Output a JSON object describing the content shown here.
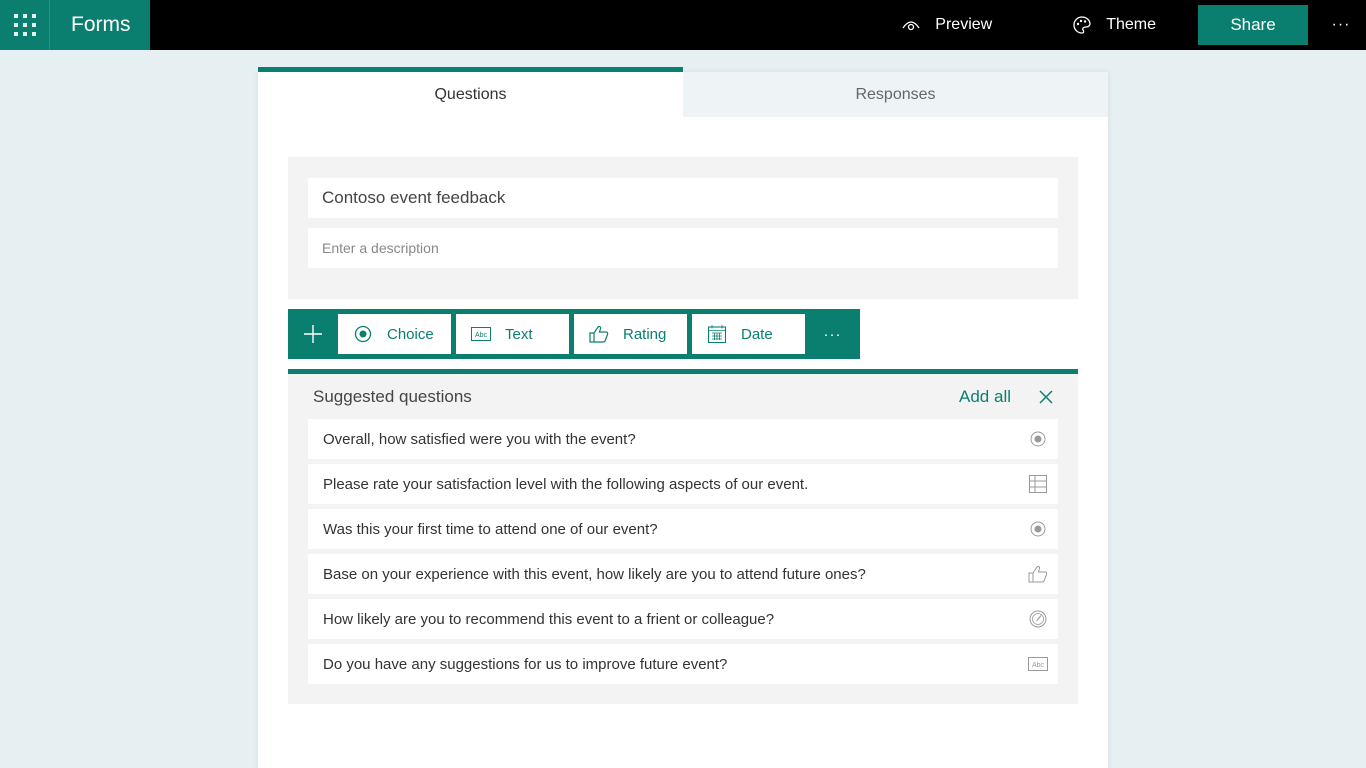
{
  "app": {
    "title": "Forms",
    "colors": {
      "accent": "#0b7f6f",
      "topbar": "#000000",
      "background": "#e6f0f2"
    }
  },
  "topbar": {
    "waffle_icon": "app-launcher-icon",
    "preview_label": "Preview",
    "preview_icon": "eye-icon",
    "theme_label": "Theme",
    "theme_icon": "palette-icon",
    "share_label": "Share",
    "more_label": "···"
  },
  "tabs": [
    {
      "label": "Questions",
      "active": true
    },
    {
      "label": "Responses",
      "active": false
    }
  ],
  "form": {
    "title": "Contoso event feedback",
    "description_placeholder": "Enter a description"
  },
  "toolbar": {
    "add_icon": "plus-icon",
    "types": [
      {
        "label": "Choice",
        "icon": "radio-icon"
      },
      {
        "label": "Text",
        "icon": "abc-icon"
      },
      {
        "label": "Rating",
        "icon": "thumbs-up-icon"
      },
      {
        "label": "Date",
        "icon": "calendar-icon"
      }
    ],
    "more_label": "···"
  },
  "suggested": {
    "title": "Suggested questions",
    "add_all_label": "Add all",
    "close_icon": "close-icon",
    "items": [
      {
        "question": "Overall, how satisfied were you with the event?",
        "type_icon": "radio-icon"
      },
      {
        "question": "Please rate your satisfaction level with the following aspects of our event.",
        "type_icon": "grid-icon"
      },
      {
        "question": "Was this your first time to attend one of our event?",
        "type_icon": "radio-icon"
      },
      {
        "question": "Base on your experience with this event, how likely are you to attend future ones?",
        "type_icon": "thumbs-up-icon"
      },
      {
        "question": "How likely are you to recommend this event to a frient or colleague?",
        "type_icon": "gauge-icon"
      },
      {
        "question": "Do you have any suggestions for us to improve future event?",
        "type_icon": "abc-icon"
      }
    ]
  }
}
